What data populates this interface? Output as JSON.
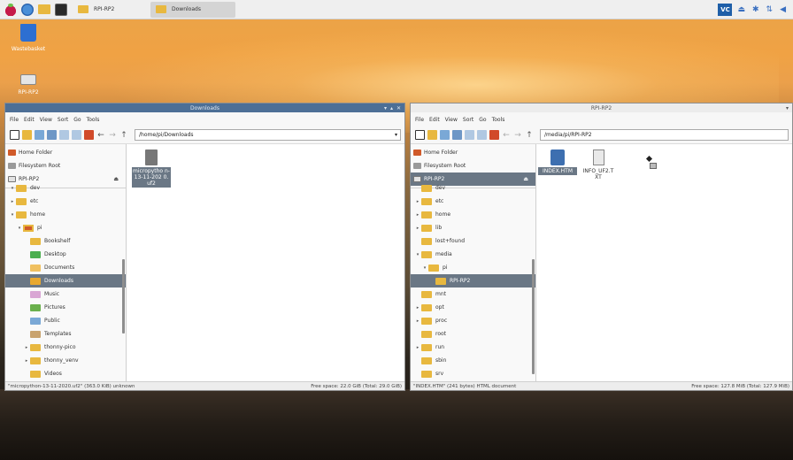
{
  "taskbar": {
    "tasks": [
      {
        "label": "RPI-RP2"
      },
      {
        "label": "Downloads"
      }
    ],
    "tray": {
      "vnc": "VC"
    }
  },
  "desktop": {
    "icons": [
      {
        "label": "Wastebasket"
      },
      {
        "label": "RPI-RP2"
      }
    ]
  },
  "left_window": {
    "title": "Downloads",
    "menu": [
      "File",
      "Edit",
      "View",
      "Sort",
      "Go",
      "Tools"
    ],
    "path": "/home/pi/Downloads",
    "places": [
      "Home Folder",
      "Filesystem Root",
      "RPI-RP2"
    ],
    "tree": [
      {
        "label": "dev",
        "twisty": "▾",
        "indent": 0
      },
      {
        "label": "etc",
        "twisty": "▸",
        "indent": 0
      },
      {
        "label": "home",
        "twisty": "▾",
        "indent": 0
      },
      {
        "label": "pi",
        "twisty": "▾",
        "indent": 1
      },
      {
        "label": "Bookshelf",
        "twisty": "",
        "indent": 2
      },
      {
        "label": "Desktop",
        "twisty": "",
        "indent": 2
      },
      {
        "label": "Documents",
        "twisty": "",
        "indent": 2
      },
      {
        "label": "Downloads",
        "twisty": "",
        "indent": 2
      },
      {
        "label": "Music",
        "twisty": "",
        "indent": 2
      },
      {
        "label": "Pictures",
        "twisty": "",
        "indent": 2
      },
      {
        "label": "Public",
        "twisty": "",
        "indent": 2
      },
      {
        "label": "Templates",
        "twisty": "",
        "indent": 2
      },
      {
        "label": "thonny-pico",
        "twisty": "▸",
        "indent": 2
      },
      {
        "label": "thonny_venv",
        "twisty": "▸",
        "indent": 2
      },
      {
        "label": "Videos",
        "twisty": "",
        "indent": 2
      }
    ],
    "files": [
      {
        "name": "micropytho n-13-11-202 0.uf2"
      }
    ],
    "status_left": "\"micropython-13-11-2020.uf2\" (363.0 KiB) unknown",
    "status_right": "Free space: 22.0 GiB (Total: 29.0 GiB)"
  },
  "right_window": {
    "title": "RPI-RP2",
    "menu": [
      "File",
      "Edit",
      "View",
      "Sort",
      "Go",
      "Tools"
    ],
    "path": "/media/pi/RPI-RP2",
    "places": [
      "Home Folder",
      "Filesystem Root",
      "RPI-RP2"
    ],
    "tree": [
      {
        "label": "dev",
        "twisty": "",
        "indent": 0
      },
      {
        "label": "etc",
        "twisty": "▸",
        "indent": 0
      },
      {
        "label": "home",
        "twisty": "▸",
        "indent": 0
      },
      {
        "label": "lib",
        "twisty": "▸",
        "indent": 0
      },
      {
        "label": "lost+found",
        "twisty": "",
        "indent": 0
      },
      {
        "label": "media",
        "twisty": "▾",
        "indent": 0
      },
      {
        "label": "pi",
        "twisty": "▾",
        "indent": 1
      },
      {
        "label": "RPI-RP2",
        "twisty": "",
        "indent": 2
      },
      {
        "label": "mnt",
        "twisty": "",
        "indent": 0
      },
      {
        "label": "opt",
        "twisty": "▸",
        "indent": 0
      },
      {
        "label": "proc",
        "twisty": "▸",
        "indent": 0
      },
      {
        "label": "root",
        "twisty": "",
        "indent": 0
      },
      {
        "label": "run",
        "twisty": "▸",
        "indent": 0
      },
      {
        "label": "sbin",
        "twisty": "",
        "indent": 0
      },
      {
        "label": "srv",
        "twisty": "",
        "indent": 0
      }
    ],
    "files": [
      {
        "name": "INDEX.HTM"
      },
      {
        "name": "INFO_UF2.T XT"
      }
    ],
    "status_left": "\"INDEX.HTM\" (241 bytes) HTML document",
    "status_right": "Free space: 127.8 MiB (Total: 127.9 MiB)"
  },
  "colors": {
    "selection": "#6a7785",
    "left_titlebar": "#4d6f96",
    "folder": "#e8b83f"
  }
}
